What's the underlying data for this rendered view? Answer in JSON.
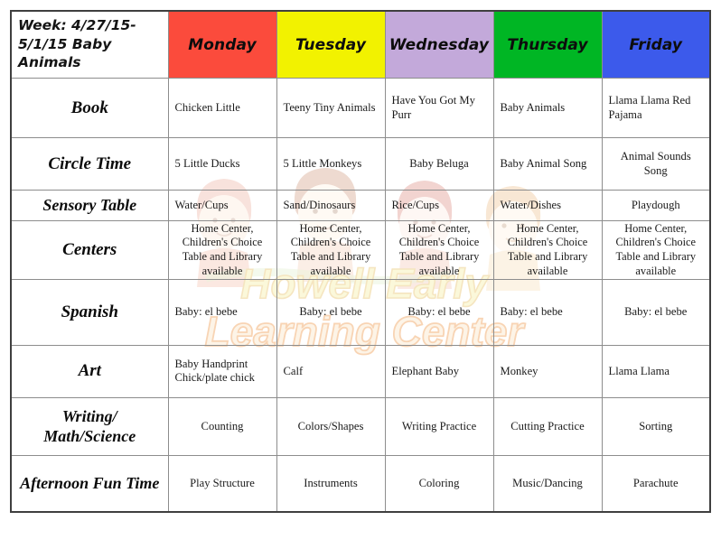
{
  "document": {
    "type": "weekly-lesson-plan-table",
    "watermark_text": "Howell Early Learning Center"
  },
  "colors": {
    "monday": "#fb4b3c",
    "tuesday": "#f2f200",
    "wednesday": "#c3a9da",
    "thursday": "#00b624",
    "friday": "#3c5aeb",
    "row_label": "#f08a1c",
    "outer_border": "#3f3f3f",
    "inner_border": "#8d8d8d",
    "watermark_yellow": "#f5e9a0",
    "watermark_orange": "#f0a95e"
  },
  "header": {
    "title": "Week: 4/27/15-5/1/15 Baby Animals",
    "days": [
      {
        "label": "Monday",
        "color": "#fb4b3c"
      },
      {
        "label": "Tuesday",
        "color": "#f2f200"
      },
      {
        "label": "Wednesday",
        "color": "#c3a9da"
      },
      {
        "label": "Thursday",
        "color": "#00b624"
      },
      {
        "label": "Friday",
        "color": "#3c5aeb"
      }
    ]
  },
  "rows": [
    {
      "label": "Book",
      "align": "left",
      "cells": [
        "Chicken Little",
        "Teeny Tiny Animals",
        "Have You Got My Purr",
        "Baby Animals",
        "Llama Llama Red Pajama"
      ]
    },
    {
      "label": "Circle Time",
      "align": "mixed",
      "cells": [
        "5 Little Ducks",
        "5 Little Monkeys",
        "Baby Beluga",
        "Baby Animal Song",
        "Animal Sounds Song"
      ]
    },
    {
      "label": "Sensory Table",
      "align": "mixed",
      "cells": [
        "Water/Cups",
        "Sand/Dinosaurs",
        "Rice/Cups",
        "Water/Dishes",
        "Playdough"
      ]
    },
    {
      "label": "Centers",
      "align": "center",
      "cells": [
        "Home Center, Children's Choice Table and Library available",
        "Home Center, Children's Choice Table and Library available",
        "Home Center, Children's Choice Table and Library available",
        "Home Center, Children's Choice Table and Library available",
        "Home Center, Children's Choice Table and Library available"
      ]
    },
    {
      "label": "Spanish",
      "align": "mixed",
      "cells": [
        "Baby: el bebe",
        "Baby: el bebe",
        "Baby: el bebe",
        "Baby: el bebe",
        "Baby: el bebe"
      ]
    },
    {
      "label": "Art",
      "align": "left",
      "cells": [
        "Baby Handprint Chick/plate chick",
        "Calf",
        "Elephant Baby",
        "Monkey",
        "Llama Llama"
      ]
    },
    {
      "label": "Writing/ Math/Science",
      "align": "center",
      "cells": [
        "Counting",
        "Colors/Shapes",
        "Writing Practice",
        "Cutting Practice",
        "Sorting"
      ]
    },
    {
      "label": "Afternoon Fun Time",
      "align": "center",
      "cells": [
        "Play Structure",
        "Instruments",
        "Coloring",
        "Music/Dancing",
        "Parachute"
      ]
    }
  ]
}
